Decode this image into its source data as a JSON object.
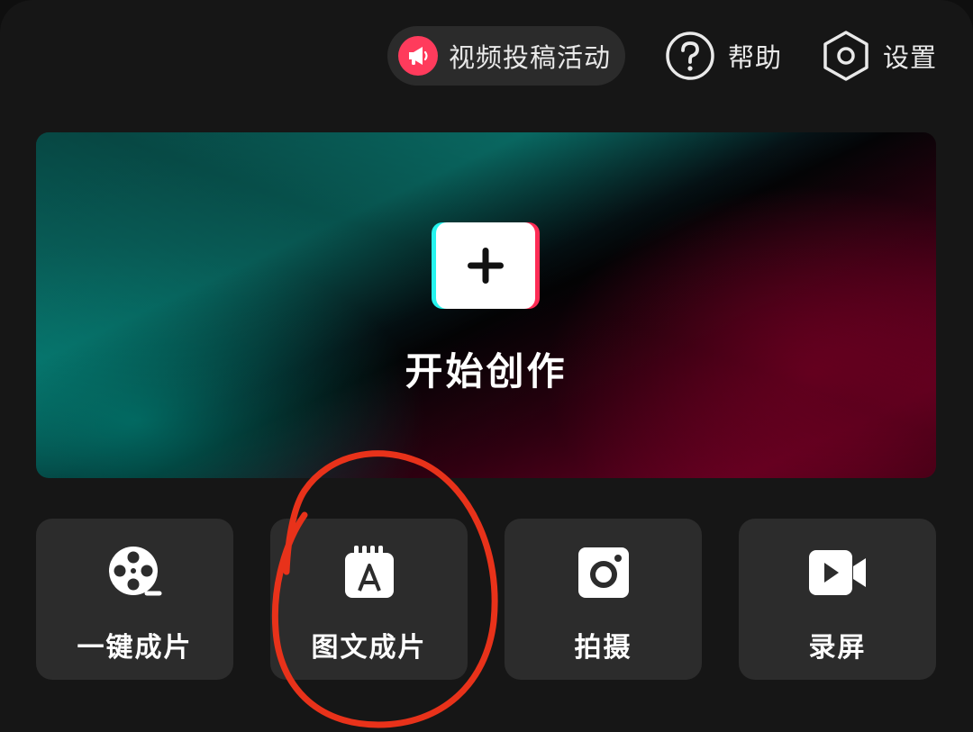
{
  "topbar": {
    "campaign_label": "视频投稿活动",
    "campaign_icon": "megaphone-icon",
    "help_label": "帮助",
    "help_icon": "question-circle-icon",
    "settings_label": "设置",
    "settings_icon": "hexagon-gear-icon"
  },
  "hero": {
    "title": "开始创作",
    "icon": "plus-icon"
  },
  "tools": [
    {
      "label": "一键成片",
      "icon": "film-reel-icon"
    },
    {
      "label": "图文成片",
      "icon": "text-notepad-icon"
    },
    {
      "label": "拍摄",
      "icon": "camera-icon"
    },
    {
      "label": "录屏",
      "icon": "video-camera-icon"
    }
  ],
  "colors": {
    "background": "#161616",
    "pill_background": "#2b2b2b",
    "tile_background": "#2c2c2c",
    "campaign_badge": "#ff3b5c",
    "accent_cyan": "#25f4ee",
    "accent_red": "#fe2c55",
    "annotation_red": "#e8321a"
  }
}
